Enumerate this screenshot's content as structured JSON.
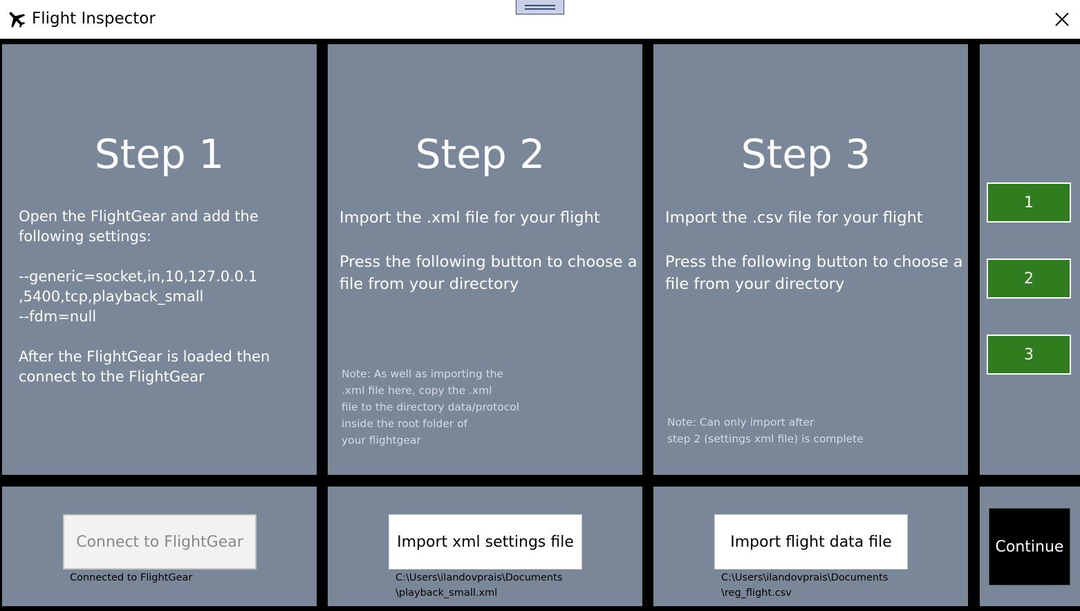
{
  "window": {
    "title": "Flight Inspector",
    "app_icon": "airplane-icon",
    "close_icon": "close-icon",
    "grip_icon": "drag-handle-icon"
  },
  "step1": {
    "title": "Step 1",
    "description": "Open the FlightGear and add the\nfollowing settings:\n\n--generic=socket,in,10,127.0.0.1\n,5400,tcp,playback_small\n--fdm=null\n\nAfter the FlightGear is loaded then\nconnect to the FlightGear",
    "button_label": "Connect to FlightGear",
    "status": "Connected to FlightGear"
  },
  "step2": {
    "title": "Step 2",
    "description": "Import the .xml file for your flight\n\nPress the following button to choose a\nfile from your directory",
    "note": "Note: As well as importing the\n.xml file here, copy the .xml\nfile to the directory data/protocol\ninside the root folder of\nyour flightgear",
    "button_label": "Import xml settings file",
    "file_path": "C:\\Users\\ilandovprais\\Documents\n\\playback_small.xml"
  },
  "step3": {
    "title": "Step 3",
    "description": "Import the .csv file for your flight\n\nPress the following button to choose a\nfile from your directory",
    "note": "Note: Can only import after\nstep 2 (settings xml file) is complete",
    "button_label": "Import flight data file",
    "file_path": "C:\\Users\\ilandovprais\\Documents\n\\reg_flight.csv"
  },
  "nav": {
    "buttons": [
      "1",
      "2",
      "3"
    ],
    "active_color": "#2f7d1f",
    "continue_label": "Continue"
  },
  "colors": {
    "panel": "#7a8798",
    "background": "#000000"
  }
}
